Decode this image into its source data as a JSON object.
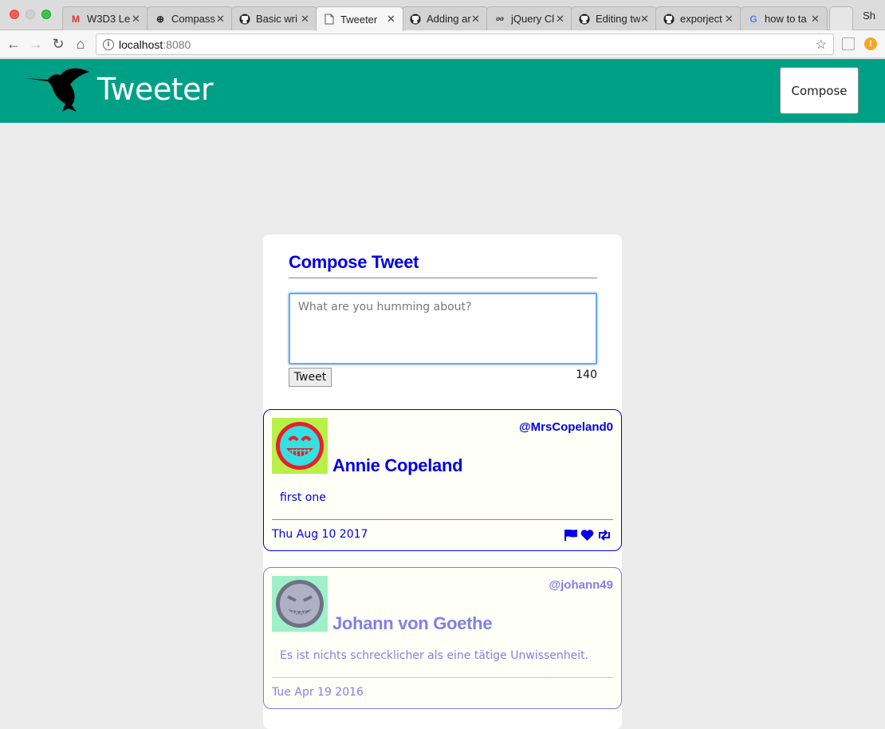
{
  "browser": {
    "tabs": [
      {
        "title": "W3D3 Le",
        "icon": "gmail-icon"
      },
      {
        "title": "Compass",
        "icon": "compass-icon"
      },
      {
        "title": "Basic wri",
        "icon": "github-icon"
      },
      {
        "title": "Tweeter",
        "icon": "document-icon",
        "active": true
      },
      {
        "title": "Adding ar",
        "icon": "github-icon"
      },
      {
        "title": "jQuery Cl",
        "icon": "jquery-icon"
      },
      {
        "title": "Editing tw",
        "icon": "github-icon"
      },
      {
        "title": "exporject",
        "icon": "github-icon"
      },
      {
        "title": "how to ta",
        "icon": "google-icon"
      }
    ],
    "profile_label": "Sh",
    "address": {
      "host": "localhost",
      "port": ":8080"
    }
  },
  "app": {
    "brand": "Tweeter",
    "compose_button": "Compose",
    "colors": {
      "header": "#00a087",
      "accent": "#0000e6",
      "faded": "#8080e8"
    }
  },
  "compose": {
    "title": "Compose Tweet",
    "placeholder": "What are you humming about?",
    "submit_label": "Tweet",
    "counter": "140"
  },
  "tweets": [
    {
      "name": "Annie Copeland",
      "handle": "@MrsCopeland0",
      "body": "first one",
      "date": "Thu Aug 10 2017",
      "avatar": "red-cyan-grinning-face-avatar"
    },
    {
      "name": "Johann von Goethe",
      "handle": "@johann49",
      "body": "Es ist nichts schrecklicher als eine tätige Unwissenheit.",
      "date": "Tue Apr 19 2016",
      "avatar": "gray-devil-face-avatar"
    }
  ]
}
